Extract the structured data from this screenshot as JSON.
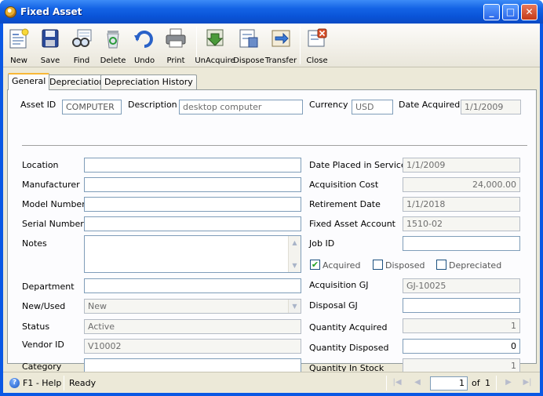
{
  "window": {
    "title": "Fixed Asset",
    "controls": [
      "_",
      "□",
      "✕"
    ]
  },
  "toolbar": {
    "buttons": [
      {
        "label": "New",
        "icon": "new-icon"
      },
      {
        "label": "Save",
        "icon": "save-icon"
      },
      {
        "label": "Find",
        "icon": "find-icon"
      },
      {
        "label": "Delete",
        "icon": "delete-icon"
      },
      {
        "label": "Undo",
        "icon": "undo-icon"
      },
      {
        "label": "Print",
        "icon": "print-icon"
      },
      {
        "label": "UnAcquire",
        "icon": "unacquire-icon"
      },
      {
        "label": "Dispose",
        "icon": "dispose-icon"
      },
      {
        "label": "Transfer",
        "icon": "transfer-icon"
      },
      {
        "label": "Close",
        "icon": "close-icon"
      }
    ]
  },
  "tabs": [
    {
      "label": "General",
      "active": true
    },
    {
      "label": "Depreciation",
      "active": false
    },
    {
      "label": "Depreciation History",
      "active": false
    }
  ],
  "header": {
    "asset_id_label": "Asset ID",
    "asset_id_value": "COMPUTER",
    "description_label": "Description",
    "description_value": "desktop computer",
    "currency_label": "Currency",
    "currency_value": "USD",
    "date_acquired_label": "Date Acquired",
    "date_acquired_value": "1/1/2009"
  },
  "left": {
    "location_label": "Location",
    "location_value": "",
    "manufacturer_label": "Manufacturer",
    "manufacturer_value": "",
    "model_number_label": "Model Number",
    "model_number_value": "",
    "serial_number_label": "Serial Number",
    "serial_number_value": "",
    "notes_label": "Notes",
    "notes_value": "",
    "department_label": "Department",
    "department_value": "",
    "new_used_label": "New/Used",
    "new_used_value": "New",
    "status_label": "Status",
    "status_value": "Active",
    "vendor_id_label": "Vendor ID",
    "vendor_id_value": "V10002",
    "category_label": "Category",
    "category_value": ""
  },
  "right": {
    "date_placed_label": "Date Placed in Service",
    "date_placed_value": "1/1/2009",
    "acquisition_cost_label": "Acquisition Cost",
    "acquisition_cost_value": "24,000.00",
    "retirement_date_label": "Retirement Date",
    "retirement_date_value": "1/1/2018",
    "fixed_asset_account_label": "Fixed Asset Account",
    "fixed_asset_account_value": "1510-02",
    "job_id_label": "Job ID",
    "job_id_value": "",
    "acquired_label": "Acquired",
    "acquired_checked": "✔",
    "disposed_label": "Disposed",
    "depreciated_label": "Depreciated",
    "acquisition_gj_label": "Acquisition GJ",
    "acquisition_gj_value": "GJ-10025",
    "disposal_gj_label": "Disposal GJ",
    "disposal_gj_value": "",
    "quantity_acquired_label": "Quantity Acquired",
    "quantity_acquired_value": "1",
    "quantity_disposed_label": "Quantity Disposed",
    "quantity_disposed_value": "0",
    "quantity_in_stock_label": "Quantity In Stock",
    "quantity_in_stock_value": "1"
  },
  "statusbar": {
    "help": "F1 - Help",
    "status": "Ready",
    "page_value": "1",
    "of_label": "of",
    "total_pages": "1",
    "nav_first": "|◀",
    "nav_prev": "◀",
    "nav_next": "▶",
    "nav_last": "▶|"
  },
  "colors": {
    "title_bar": "#0a54d8",
    "client_bg": "#ece9d8",
    "active_tab_accent": "#f8b838",
    "field_border": "#7f9db9"
  }
}
